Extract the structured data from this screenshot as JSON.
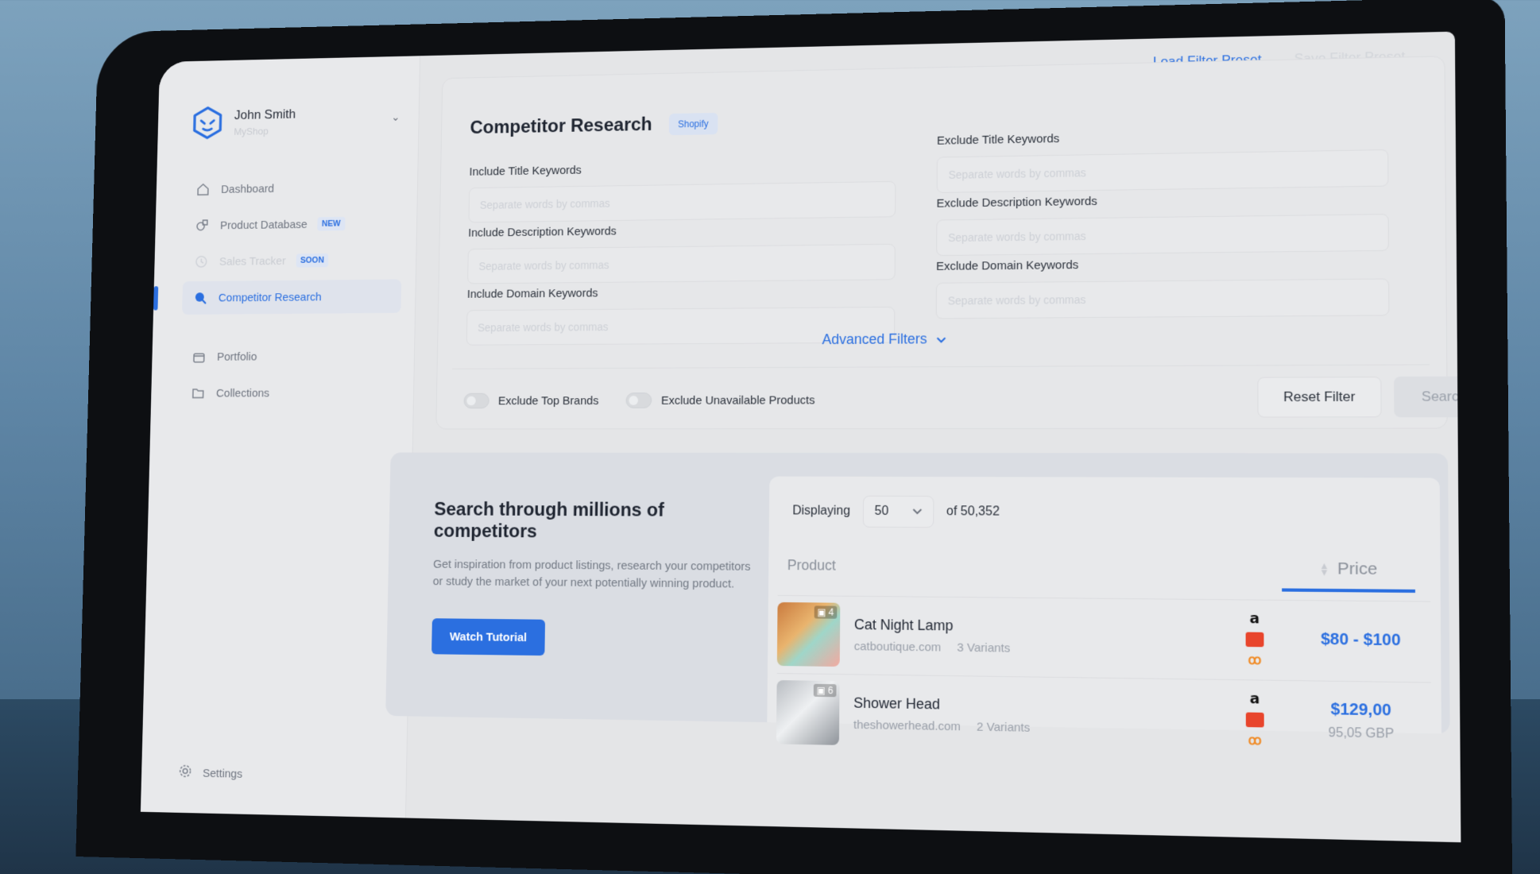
{
  "profile": {
    "name": "John Smith",
    "shop": "MyShop"
  },
  "nav": {
    "items": [
      {
        "label": "Dashboard"
      },
      {
        "label": "Product Database",
        "badge": "NEW"
      },
      {
        "label": "Sales Tracker",
        "badge": "SOON"
      },
      {
        "label": "Competitor Research"
      },
      {
        "label": "Portfolio"
      },
      {
        "label": "Collections"
      }
    ],
    "settings": "Settings"
  },
  "top": {
    "load_preset": "Load Filter Preset",
    "save_preset": "Save Filter Preset"
  },
  "filters": {
    "title": "Competitor Research",
    "platform_badge": "Shopify",
    "include_title": {
      "label": "Include Title Keywords",
      "placeholder": "Separate words by commas"
    },
    "include_description": {
      "label": "Include Description Keywords",
      "placeholder": "Separate words by commas"
    },
    "include_domain": {
      "label": "Include Domain Keywords",
      "placeholder": "Separate words by commas"
    },
    "exclude_title": {
      "label": "Exclude Title Keywords",
      "placeholder": "Separate words by commas"
    },
    "exclude_description": {
      "label": "Exclude Description Keywords",
      "placeholder": "Separate words by commas"
    },
    "exclude_domain": {
      "label": "Exclude Domain Keywords",
      "placeholder": "Separate words by commas"
    },
    "advanced": "Advanced Filters",
    "toggle_top_brands": "Exclude Top Brands",
    "toggle_unavailable": "Exclude Unavailable Products",
    "reset": "Reset Filter",
    "search": "Search"
  },
  "promo": {
    "title": "Search through millions of competitors",
    "text": "Get inspiration from product listings, research your competitors or study the market of your next potentially winning product.",
    "button": "Watch Tutorial"
  },
  "table": {
    "displaying_label": "Displaying",
    "per_page": "50",
    "total": "of 50,352",
    "col_product": "Product",
    "col_price": "Price",
    "rows": [
      {
        "images": "4",
        "name": "Cat Night Lamp",
        "domain": "catboutique.com",
        "variants": "3 Variants",
        "price": "$80 - $100",
        "price_alt": ""
      },
      {
        "images": "6",
        "name": "Shower Head",
        "domain": "theshowerhead.com",
        "variants": "2 Variants",
        "price": "$129,00",
        "price_alt": "95,05 GBP"
      }
    ]
  },
  "colors": {
    "accent": "#2b6fe0"
  }
}
